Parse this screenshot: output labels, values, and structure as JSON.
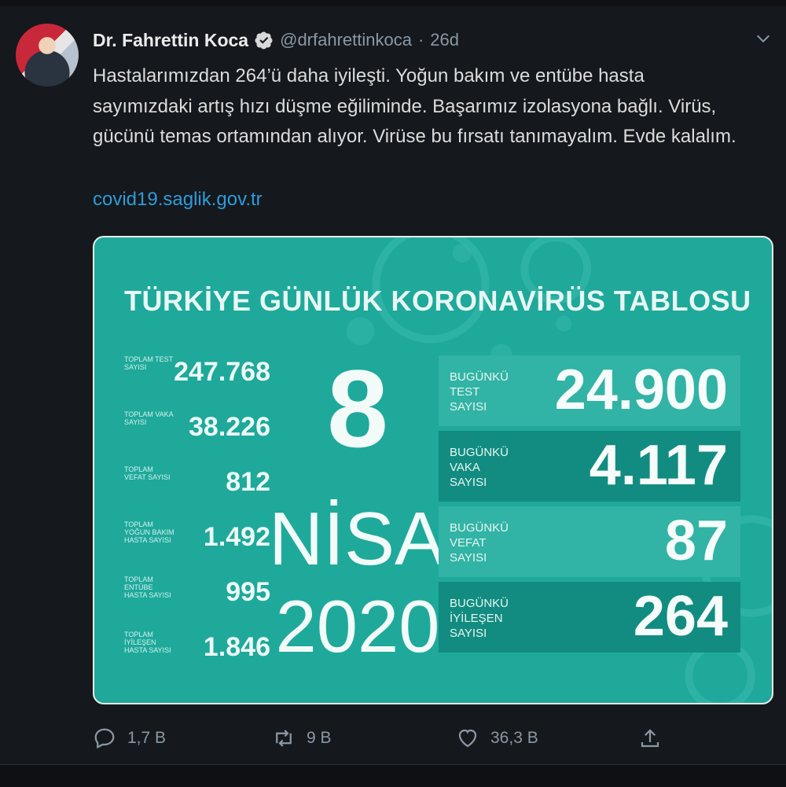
{
  "tweet": {
    "author_name": "Dr. Fahrettin Koca",
    "handle": "@drfahrettinkoca",
    "separator": "·",
    "time": "26d",
    "text_lines": [
      "Hastalarımızdan 264’ü daha iyileşti. Yoğun bakım ve entübe hasta",
      "sayımızdaki artış hızı düşme eğiliminde. Başarımız izolasyona bağlı. Virüs,",
      "gücünü temas ortamından alıyor. Virüse bu fırsatı tanımayalım. Evde kalalım."
    ],
    "link": "covid19.saglik.gov.tr"
  },
  "card": {
    "title": "TÜRKİYE GÜNLÜK KORONAVİRÜS TABLOSU",
    "left_stats": [
      {
        "label": "TOPLAM TEST SAYISI",
        "value": "247.768"
      },
      {
        "label": "TOPLAM VAKA SAYISI",
        "value": "38.226"
      },
      {
        "label": "TOPLAM VEFAT SAYISI",
        "value": "812"
      },
      {
        "label": "TOPLAM YOĞUN BAKIM HASTA SAYISI",
        "value": "1.492"
      },
      {
        "label": "TOPLAM ENTÜBE HASTA SAYISI",
        "value": "995"
      },
      {
        "label": "TOPLAM İYİLEŞEN HASTA SAYISI",
        "value": "1.846"
      }
    ],
    "date": {
      "day": "8",
      "month": "NİSAN",
      "year": "2020"
    },
    "right_stats": [
      {
        "label": "BUGÜNKÜ TEST SAYISI",
        "value": "24.900"
      },
      {
        "label": "BUGÜNKÜ VAKA SAYISI",
        "value": "4.117"
      },
      {
        "label": "BUGÜNKÜ VEFAT SAYISI",
        "value": "87"
      },
      {
        "label": "BUGÜNKÜ İYİLEŞEN SAYISI",
        "value": "264"
      }
    ]
  },
  "actions": {
    "reply_count": "1,7 B",
    "retweet_count": "9 B",
    "like_count": "36,3 B"
  },
  "icons": [
    "verified-icon",
    "chevron-down-icon",
    "reply-icon",
    "retweet-icon",
    "like-icon",
    "share-icon"
  ],
  "colors": {
    "background": "#15181c",
    "link": "#2d9cdb",
    "card": "#1ea99b"
  }
}
